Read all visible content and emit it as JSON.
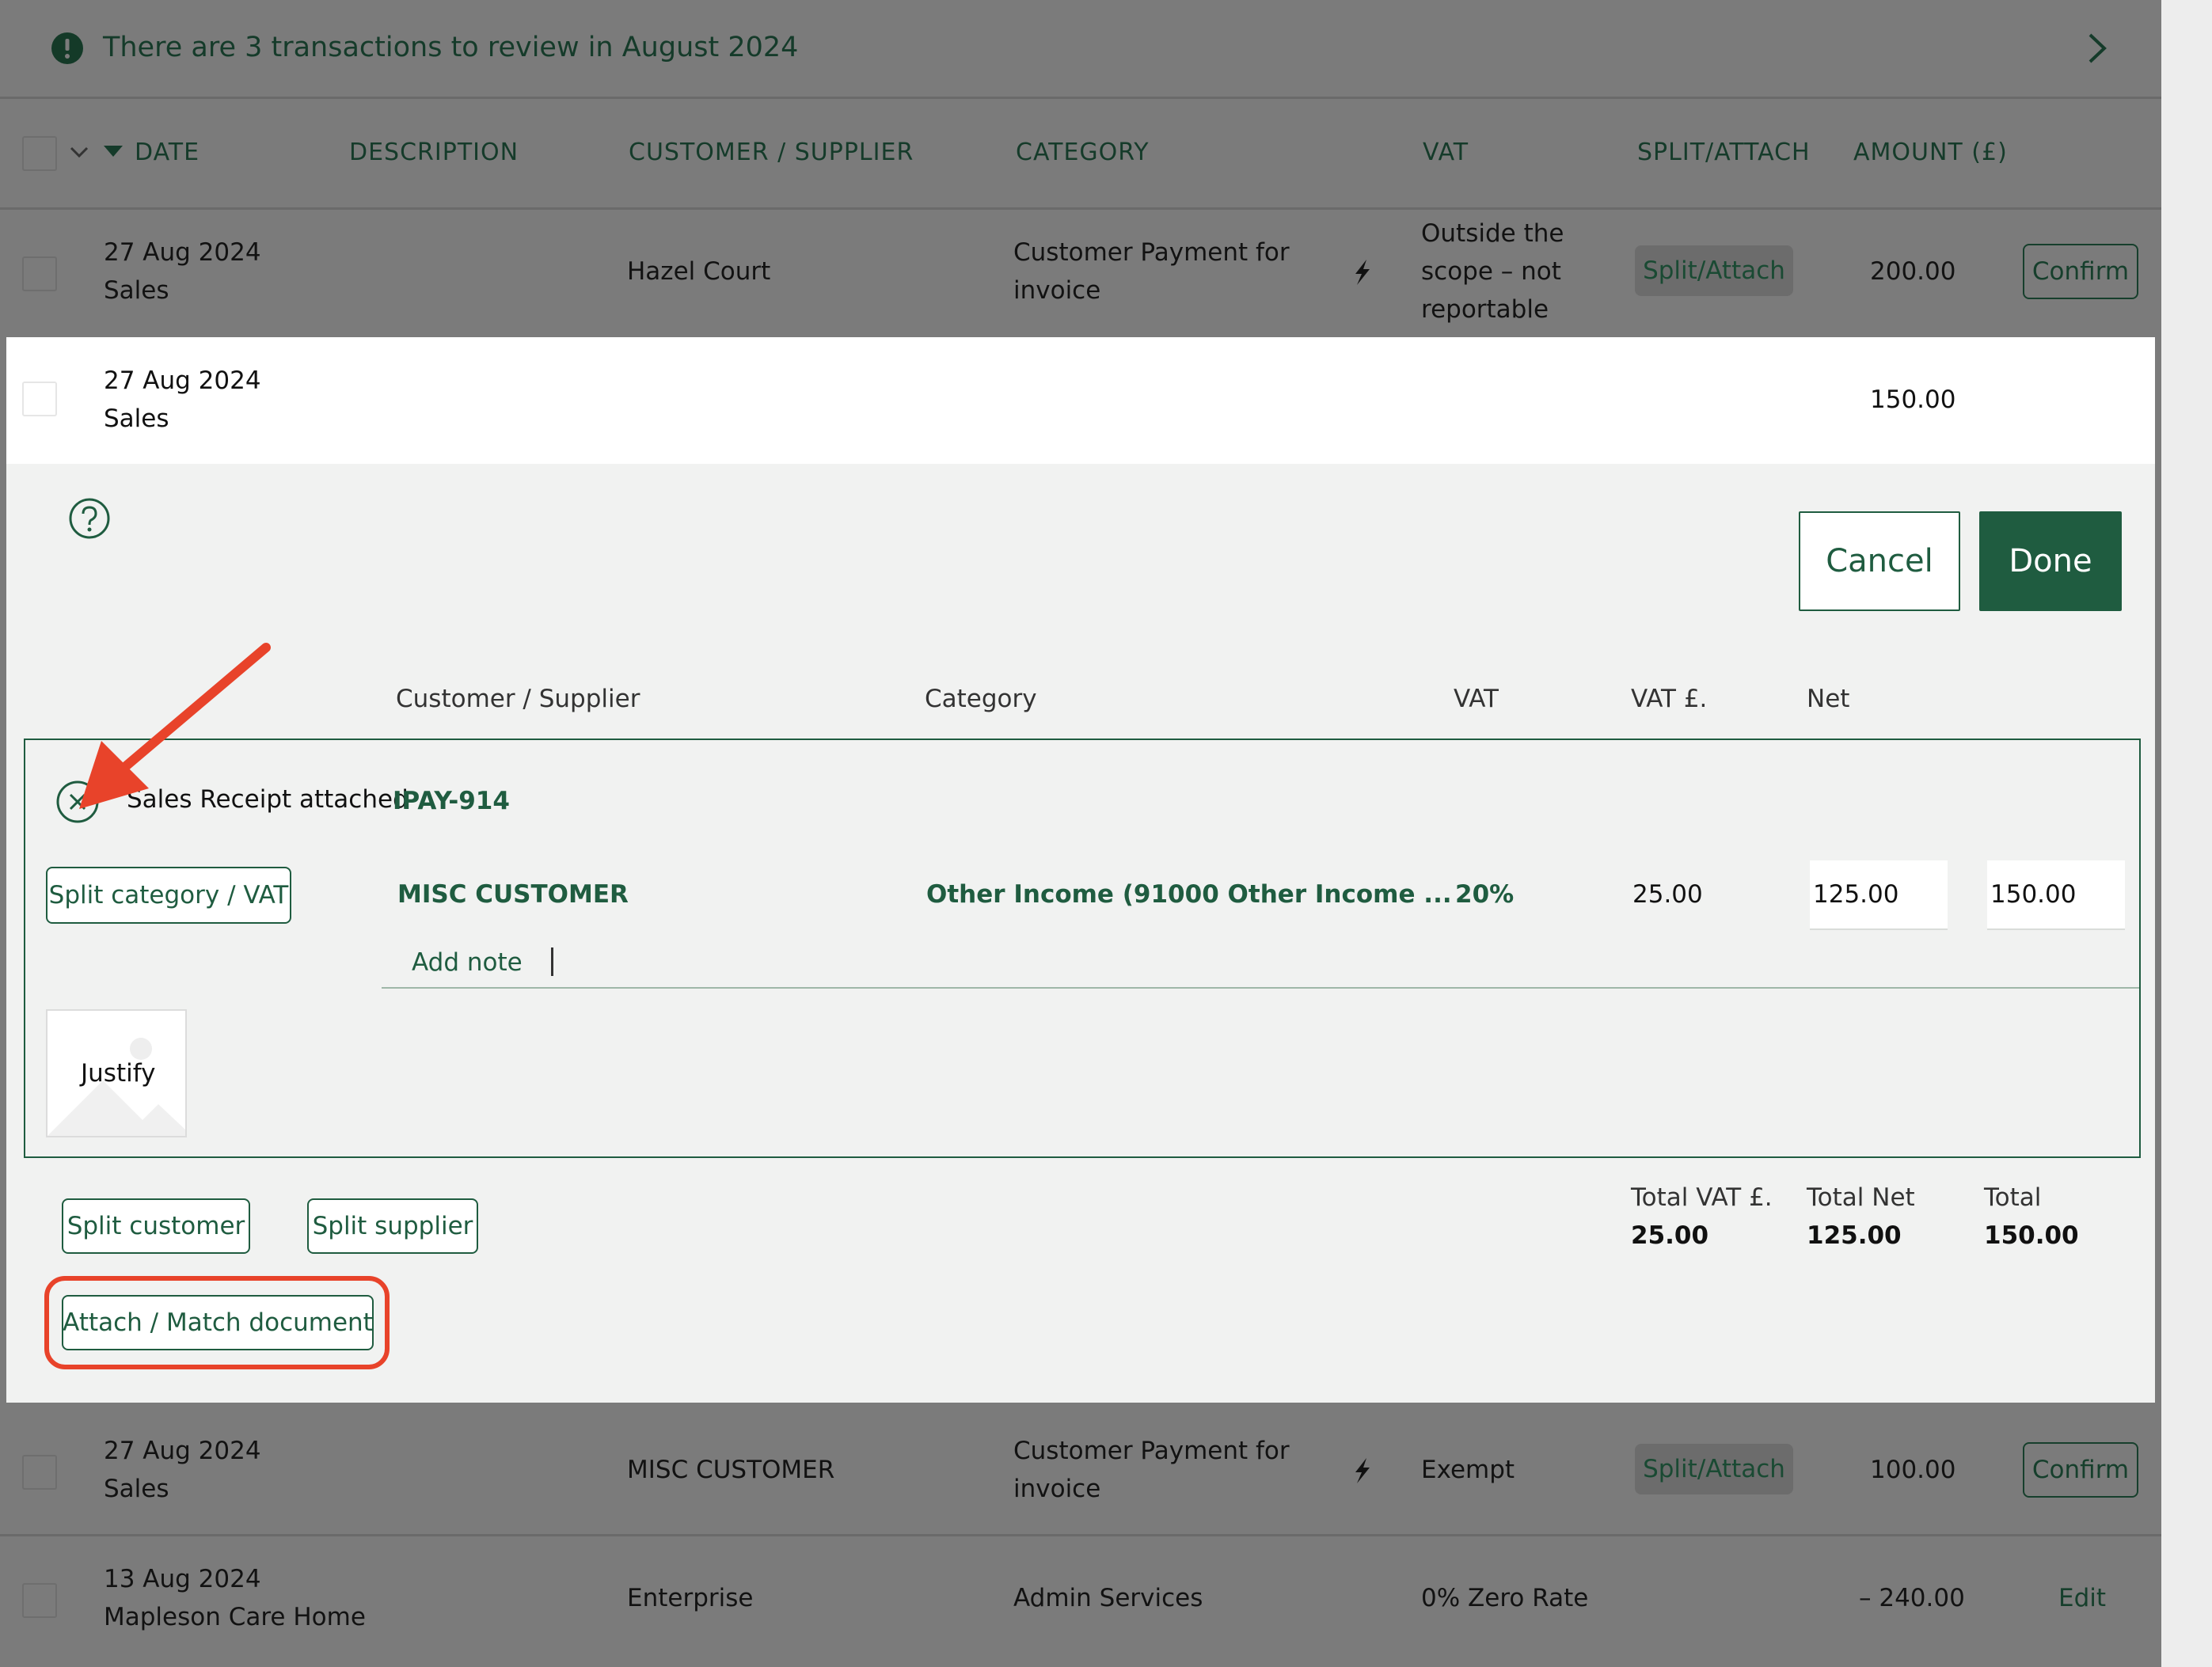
{
  "banner": {
    "text": "There are 3 transactions to review in August 2024"
  },
  "columns": {
    "date": "DATE",
    "description": "DESCRIPTION",
    "customer_supplier": "CUSTOMER / SUPPLIER",
    "category": "CATEGORY",
    "vat": "VAT",
    "split_attach": "SPLIT/ATTACH",
    "amount": "AMOUNT (£)"
  },
  "rows": [
    {
      "date": "27 Aug 2024",
      "type": "Sales",
      "customer": "Hazel Court",
      "category_l1": "Customer Payment for",
      "category_l2": "invoice",
      "vat_l1": "Outside the",
      "vat_l2": "scope – not",
      "vat_l3": "reportable",
      "split_label": "Split/Attach",
      "amount": "200.00",
      "action": "Confirm"
    },
    {
      "date": "27 Aug 2024",
      "type": "Sales",
      "amount": "150.00"
    },
    {
      "date": "27 Aug 2024",
      "type": "Sales",
      "customer": "MISC CUSTOMER",
      "category_l1": "Customer Payment for",
      "category_l2": "invoice",
      "vat": "Exempt",
      "split_label": "Split/Attach",
      "amount": "100.00",
      "action": "Confirm"
    },
    {
      "date": "13 Aug 2024",
      "type": "Mapleson Care Home",
      "customer": "Enterprise",
      "category": "Admin Services",
      "vat": "0% Zero Rate",
      "amount": "– 240.00",
      "action": "Edit"
    }
  ],
  "editor": {
    "cancel": "Cancel",
    "done": "Done",
    "headers": {
      "customer_supplier": "Customer / Supplier",
      "category": "Category",
      "vat": "VAT",
      "vat_amount": "VAT £.",
      "net": "Net"
    },
    "receipt_label": "Sales Receipt attached",
    "receipt_ref": "IPAY-914",
    "split_category_vat": "Split category / VAT",
    "line": {
      "customer": "MISC CUSTOMER",
      "category": "Other Income (91000 Other Income ...",
      "vat_rate": "20%",
      "vat_amount": "25.00",
      "net": "125.00",
      "gross": "150.00"
    },
    "add_note": "Add note",
    "justify": "Justify",
    "split_customer": "Split customer",
    "split_supplier": "Split supplier",
    "attach_match": "Attach / Match document",
    "totals": {
      "vat_label": "Total VAT £.",
      "vat_value": "25.00",
      "net_label": "Total Net",
      "net_value": "125.00",
      "total_label": "Total",
      "total_value": "150.00"
    }
  },
  "colors": {
    "accent": "#1f5c40",
    "overlay": "#7b7b7b",
    "highlight": "#e8432a",
    "panel": "#f1f2f1"
  }
}
